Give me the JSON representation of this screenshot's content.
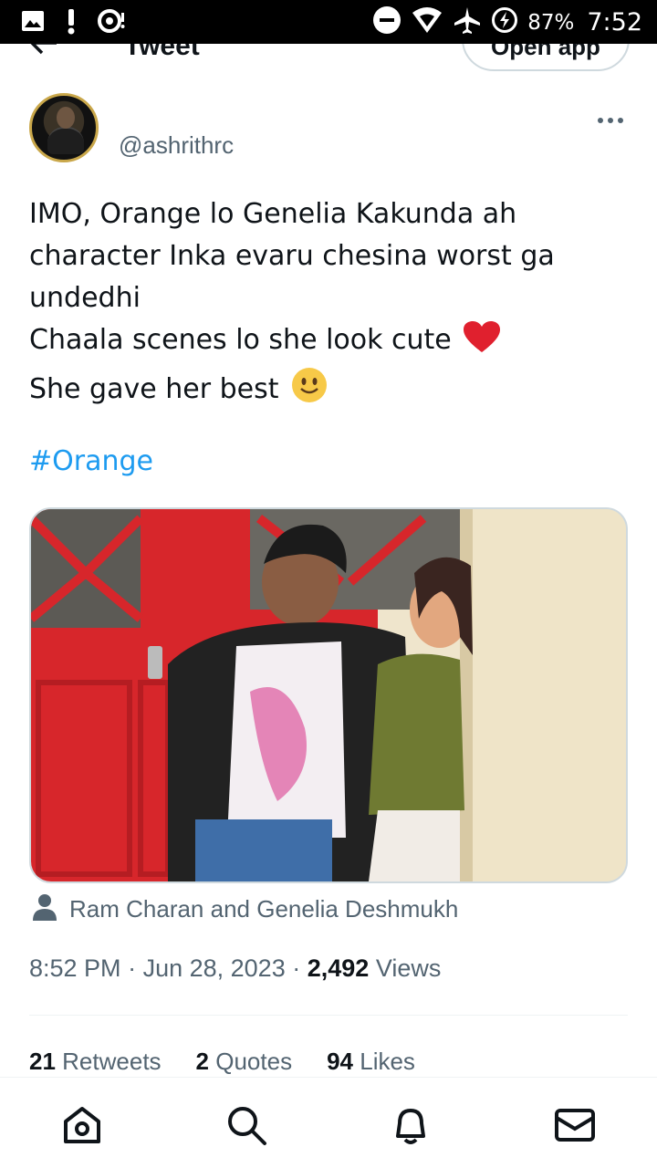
{
  "status_bar": {
    "battery": "87%",
    "time": "7:52",
    "icons": [
      "image-icon",
      "alert-icon",
      "sync-icon",
      "dnd-icon",
      "wifi-icon",
      "airplane-icon",
      "battery-saver-icon"
    ]
  },
  "header": {
    "title": "Tweet",
    "open_app_label": "Open app"
  },
  "author": {
    "handle": "@ashrithrc"
  },
  "tweet": {
    "lines": [
      "IMO, Orange lo Genelia Kakunda ah",
      "character Inka evaru chesina worst ga",
      "undedhi",
      "Chaala scenes lo she look cute",
      "She gave her best"
    ],
    "hashtag": "#Orange",
    "tagged": "Ram Charan and Genelia Deshmukh"
  },
  "meta": {
    "time": "8:52 PM",
    "date": "Jun 28, 2023",
    "views_count": "2,492",
    "views_label": "Views"
  },
  "stats": {
    "retweets_count": "21",
    "retweets_label": "Retweets",
    "quotes_count": "2",
    "quotes_label": "Quotes",
    "likes_count": "94",
    "likes_label": "Likes"
  },
  "colors": {
    "accent": "#1d9bf0",
    "text_primary": "#0f1419",
    "text_secondary": "#536471",
    "heart": "#e0202e"
  }
}
